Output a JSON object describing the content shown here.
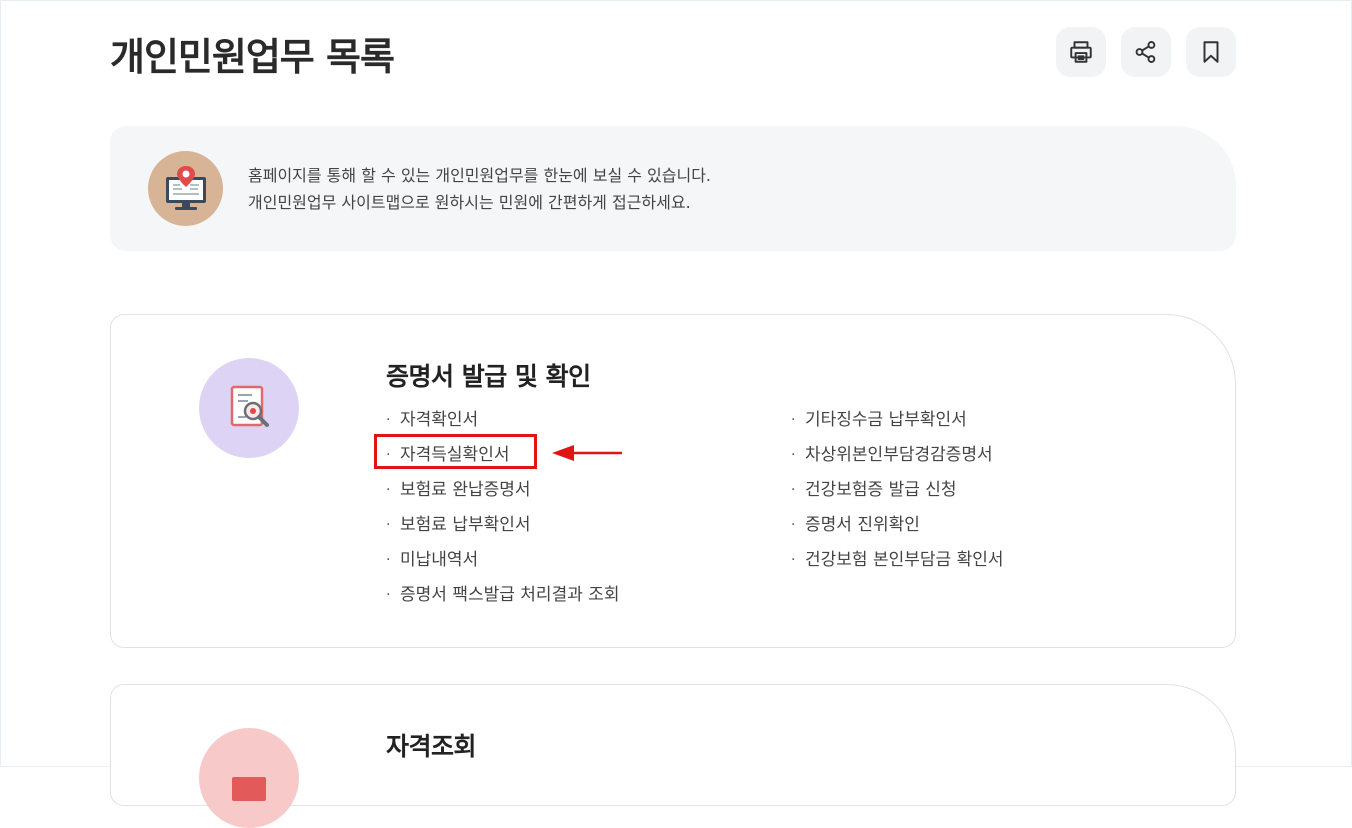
{
  "page": {
    "title": "개인민원업무 목록"
  },
  "toolbar": {
    "print_icon": "print-icon",
    "share_icon": "share-icon",
    "bookmark_icon": "bookmark-icon"
  },
  "intro": {
    "icon": "monitor-location-icon",
    "line1": "홈페이지를 통해 할 수 있는 개인민원업무를 한눈에 보실 수 있습니다.",
    "line2": "개인민원업무 사이트맵으로 원하시는 민원에 간편하게 접근하세요."
  },
  "sections": [
    {
      "title": "증명서 발급 및 확인",
      "icon": "document-search-icon",
      "left_links": [
        "자격확인서",
        "자격득실확인서",
        "보험료 완납증명서",
        "보험료 납부확인서",
        "미납내역서",
        "증명서 팩스발급 처리결과 조회"
      ],
      "right_links": [
        "기타징수금 납부확인서",
        "차상위본인부담경감증명서",
        "건강보험증 발급 신청",
        "증명서 진위확인",
        "건강보험 본인부담금 확인서"
      ]
    },
    {
      "title": "자격조회",
      "icon": "id-card-icon"
    }
  ],
  "bullet": "·",
  "colors": {
    "highlight": "#e01414",
    "intro_bg": "#f5f6f8",
    "section1_icon_bg": "#ddd4f5",
    "section2_icon_bg": "#f8c9c9"
  }
}
